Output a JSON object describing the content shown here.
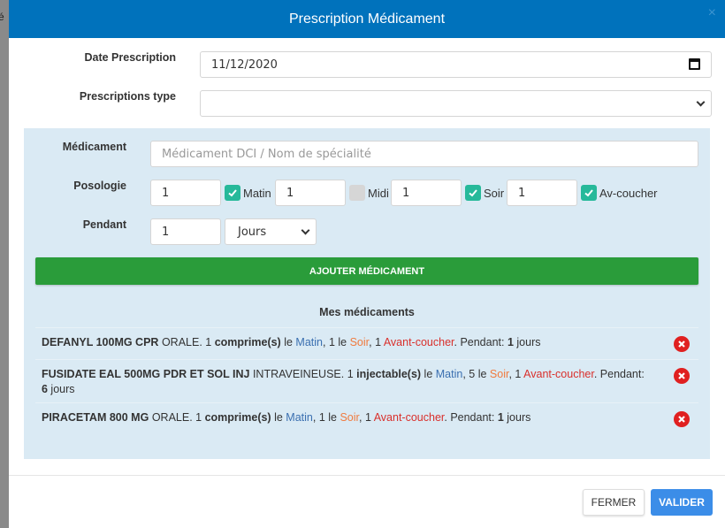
{
  "backdrop": {
    "fragment": "é"
  },
  "modal": {
    "title": "Prescription Médicament",
    "close": "×"
  },
  "form": {
    "date_label": "Date Prescription",
    "date_value": "11/12/2020",
    "type_label": "Prescriptions type",
    "type_value": ""
  },
  "panel": {
    "med_label": "Médicament",
    "med_placeholder": "Médicament DCI / Nom de spécialité",
    "posology_label": "Posologie",
    "posology": [
      {
        "value": "1",
        "checked": true,
        "label": "Matin"
      },
      {
        "value": "1",
        "checked": false,
        "label": "Midi"
      },
      {
        "value": "1",
        "checked": true,
        "label": "Soir"
      },
      {
        "value": "1",
        "checked": true,
        "label": "Av-coucher"
      }
    ],
    "duration_label": "Pendant",
    "duration_value": "1",
    "duration_unit": "Jours",
    "add_button": "AJOUTER MÉDICAMENT",
    "list_title": "Mes médicaments"
  },
  "medications": [
    {
      "name": "DEFANYL 100MG CPR",
      "route": "ORALE. ",
      "qty1": "1",
      "form": "comprime(s)",
      "le1": " le ",
      "t1": "Matin",
      "sep1": ", 1 le ",
      "t2": "Soir",
      "sep2": ", 1 ",
      "t3": "Avant-coucher",
      "pend": ". Pendant: ",
      "days": "1",
      "unit": " jours"
    },
    {
      "name": "FUSIDATE EAL 500MG PDR ET SOL INJ",
      "route": "INTRAVEINEUSE. ",
      "qty1": "1",
      "form": "injectable(s)",
      "le1": " le ",
      "t1": "Matin",
      "sep1": ", 5 le ",
      "t2": "Soir",
      "sep2": ", 1 ",
      "t3": "Avant-coucher",
      "pend": ". Pendant: ",
      "days": "6",
      "unit": " jours"
    },
    {
      "name": "PIRACETAM 800 MG",
      "route": "ORALE. ",
      "qty1": "1",
      "form": "comprime(s)",
      "le1": " le ",
      "t1": "Matin",
      "sep1": ", 1 le ",
      "t2": "Soir",
      "sep2": ", 1 ",
      "t3": "Avant-coucher",
      "pend": ". Pendant: ",
      "days": "1",
      "unit": " jours"
    }
  ],
  "footer": {
    "close_label": "FERMER",
    "validate_label": "VALIDER"
  },
  "colors": {
    "header": "#0072bc",
    "add_button": "#2a9c3a",
    "validate": "#3b8de8",
    "panel": "#daeaf4",
    "check": "#26b99a"
  }
}
